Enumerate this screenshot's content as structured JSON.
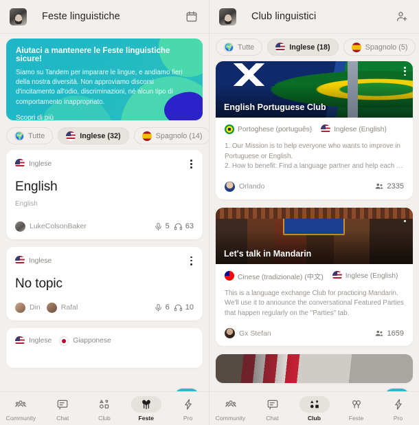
{
  "left": {
    "header": {
      "title": "Feste linguistiche",
      "avatar": "user-avatar",
      "action_icon": "calendar-icon"
    },
    "banner": {
      "title": "Aiutaci a mantenere le Feste linguistiche sicure!",
      "text": "Siamo su Tandem per imparare le lingue, e andiamo fieri della nostra diversità. Non approviamo discorsi d'incitamento all'odio, discriminazioni, né alcun tipo di comportamento inappropriato.",
      "link": "Scopri di più",
      "bg_color": "#22b9c4",
      "accent_color": "#4ddbab",
      "blob_color": "#2b22c9"
    },
    "chips": [
      {
        "label": "Tutte",
        "flag": "world-icon",
        "active": false
      },
      {
        "label": "Inglese (32)",
        "flag": "us-flag",
        "active": true
      },
      {
        "label": "Spagnolo (14)",
        "flag": "es-flag",
        "active": false
      },
      {
        "label": "",
        "flag": "jp-flag",
        "active": false,
        "clipped": true
      }
    ],
    "cards": [
      {
        "language": "Inglese",
        "flag": "us-flag",
        "title": "English",
        "subtitle": "English",
        "host": "LukeColsonBaker",
        "speakers": "5",
        "listeners": "63"
      },
      {
        "language": "Inglese",
        "flag": "us-flag",
        "title": "No topic",
        "subtitle": "",
        "host": "Din",
        "host2": "Rafal",
        "speakers": "6",
        "listeners": "10"
      },
      {
        "language": "Inglese",
        "flag": "us-flag",
        "language2": "Giapponese",
        "flag2": "jp-flag",
        "clipped": true
      }
    ],
    "fab": {
      "label": "+",
      "color": "#2fb6d0"
    },
    "nav": [
      {
        "label": "Community",
        "icon": "community-icon",
        "active": false
      },
      {
        "label": "Chat",
        "icon": "chat-icon",
        "active": false
      },
      {
        "label": "Club",
        "icon": "club-icon",
        "active": false
      },
      {
        "label": "Feste",
        "icon": "feste-icon",
        "active": true
      },
      {
        "label": "Pro",
        "icon": "pro-icon",
        "active": false
      }
    ]
  },
  "right": {
    "header": {
      "title": "Club linguistici",
      "avatar": "user-avatar",
      "action_icon": "add-person-icon"
    },
    "chips": [
      {
        "label": "Tutte",
        "flag": "world-icon",
        "active": false
      },
      {
        "label": "Inglese (18)",
        "flag": "us-flag",
        "active": true
      },
      {
        "label": "Spagnolo (5)",
        "flag": "es-flag",
        "active": false
      },
      {
        "label": "",
        "flag": "de-flag",
        "active": false,
        "clipped": true
      }
    ],
    "clubs": [
      {
        "name": "English Portuguese Club",
        "hero": "australia-brazil-flags-photo",
        "lang1": "Portoghese (português)",
        "flag1": "br-flag",
        "lang2": "Inglese (English)",
        "flag2": "us-flag",
        "description": "1. Our Mission is to help everyone who wants to improve in Portuguese or English.\n2. How to benefit: Find a language partner and help each …",
        "owner": "Orlando",
        "members": "2335"
      },
      {
        "name": "Let's talk in Mandarin",
        "hero": "chinese-archway-photo",
        "lang1": "Cinese (tradizionale) (中文)",
        "flag1": "tw-flag",
        "lang2": "Inglese (English)",
        "flag2": "us-flag",
        "description": "This is a language exchange Club for practicing Mandarin. We'll use it to announce the conversational Featured Parties that happen regularly on the \"Parties\" tab.",
        "owner": "Gx Stefan",
        "members": "1659"
      },
      {
        "name": "",
        "hero": "usa-flag-photo",
        "clipped": true
      }
    ],
    "fab": {
      "label": "+",
      "color": "#2fb6d0"
    },
    "nav": [
      {
        "label": "Community",
        "icon": "community-icon",
        "active": false
      },
      {
        "label": "Chat",
        "icon": "chat-icon",
        "active": false
      },
      {
        "label": "Club",
        "icon": "club-icon",
        "active": true
      },
      {
        "label": "Feste",
        "icon": "feste-icon",
        "active": false
      },
      {
        "label": "Pro",
        "icon": "pro-icon",
        "active": false
      }
    ]
  }
}
